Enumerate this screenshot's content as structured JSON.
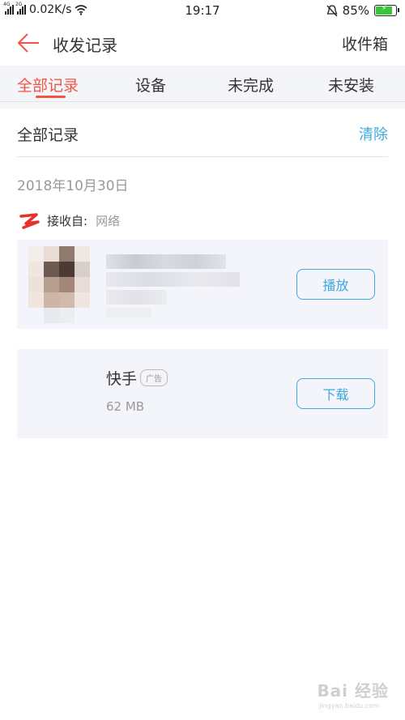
{
  "status_bar": {
    "signal1_tag": "4G",
    "signal2_tag": "2G",
    "speed": "0.02K/s",
    "time": "19:17",
    "battery_percent": "85%",
    "battery_level": 0.85
  },
  "header": {
    "title": "收发记录",
    "action_label": "收件箱"
  },
  "tabs": [
    {
      "label": "全部记录",
      "active": true
    },
    {
      "label": "设备",
      "active": false
    },
    {
      "label": "未完成",
      "active": false
    },
    {
      "label": "未安装",
      "active": false
    }
  ],
  "section": {
    "title": "全部记录",
    "clear_label": "清除"
  },
  "record_group": {
    "date": "2018年10月30日",
    "source_label": "接收自:",
    "source_value": "网络"
  },
  "video_item": {
    "action_label": "播放"
  },
  "ad_item": {
    "name": "快手",
    "badge": "广告",
    "size": "62 MB",
    "action_label": "下载"
  },
  "watermark": {
    "text": "Bai 经验",
    "sub": "jingyan.baidu.com"
  },
  "colors": {
    "accent": "#f25547",
    "link": "#3fa8e0",
    "surface": "#f4f5fa"
  }
}
